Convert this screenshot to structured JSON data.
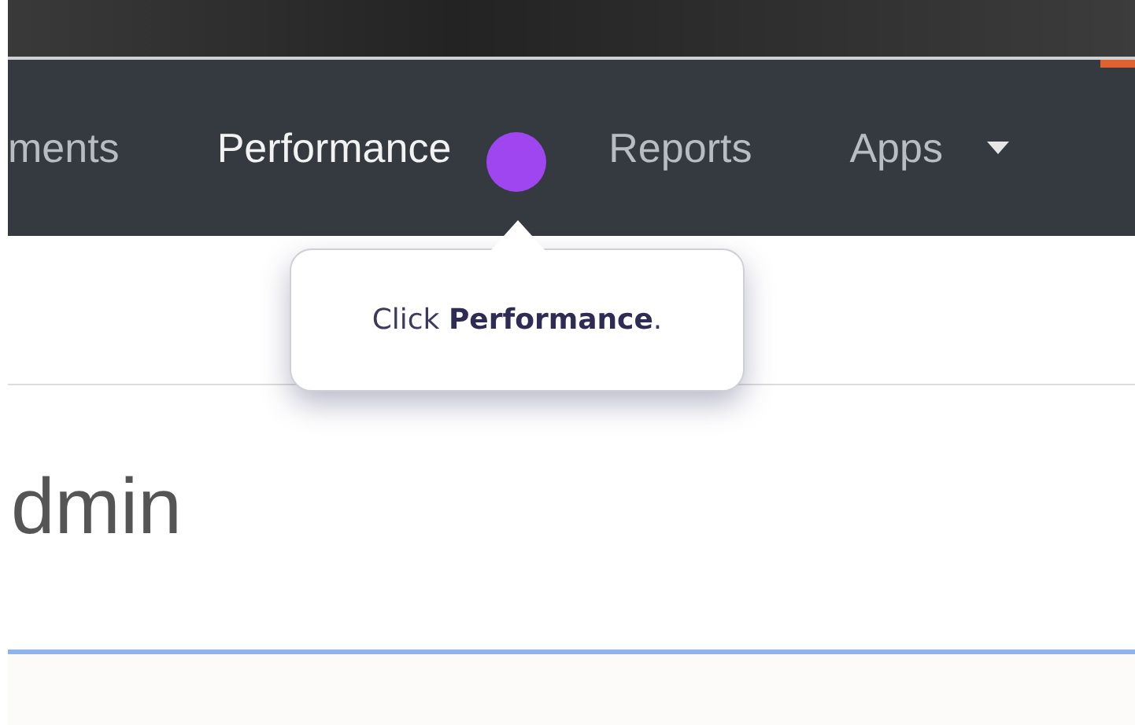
{
  "nav": {
    "items": [
      {
        "label": "ments",
        "selected": false,
        "dropdown": false
      },
      {
        "label": "Performance",
        "selected": true,
        "dropdown": false
      },
      {
        "label": "Reports",
        "selected": false,
        "dropdown": false
      },
      {
        "label": "Apps",
        "selected": false,
        "dropdown": true
      }
    ]
  },
  "tooltip": {
    "text": "Click **Performance**."
  },
  "page": {
    "heading": "dmin"
  }
}
